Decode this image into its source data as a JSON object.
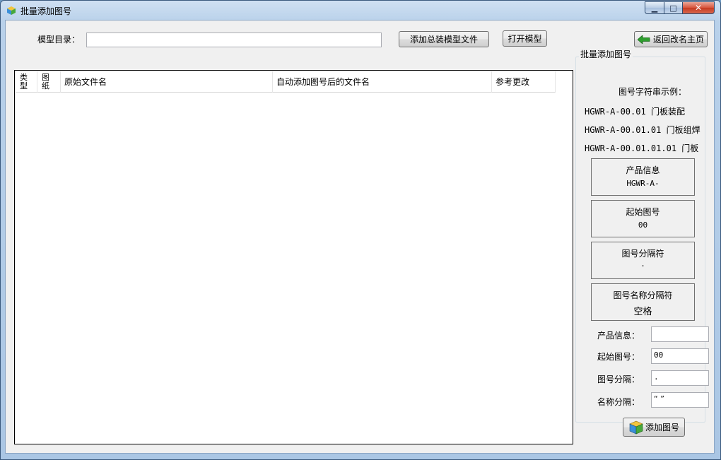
{
  "window": {
    "title": "批量添加图号"
  },
  "toolbar": {
    "model_dir_label": "模型目录：",
    "model_dir_value": "",
    "add_assembly_label": "添加总装模型文件",
    "open_model_label": "打开模型",
    "back_label": "返回改名主页"
  },
  "list": {
    "columns": [
      "类型",
      "图纸",
      "原始文件名",
      "自动添加图号后的文件名",
      "参考更改"
    ],
    "rows": []
  },
  "panel": {
    "title": "批量添加图号",
    "example_heading": "图号字符串示例：",
    "examples": [
      {
        "code": "HGWR-A-00.01",
        "name": "门板装配"
      },
      {
        "code": "HGWR-A-00.01.01",
        "name": "门板组焊"
      },
      {
        "code": "HGWR-A-00.01.01.01",
        "name": "门板"
      }
    ],
    "cards": [
      {
        "title": "产品信息",
        "value": "HGWR-A-"
      },
      {
        "title": "起始图号",
        "value": "00"
      },
      {
        "title": "图号分隔符",
        "value": "."
      },
      {
        "title": "图号名称分隔符",
        "value": "空格"
      }
    ],
    "fields": [
      {
        "label": "产品信息：",
        "value": ""
      },
      {
        "label": "起始图号：",
        "value": "00"
      },
      {
        "label": "图号分隔：",
        "value": "."
      },
      {
        "label": "名称分隔：",
        "value": "“ ”"
      }
    ],
    "add_button_label": "添加图号"
  },
  "colors": {
    "accent_green": "#2e9e2e",
    "title_bar": "#b9d1ea"
  }
}
